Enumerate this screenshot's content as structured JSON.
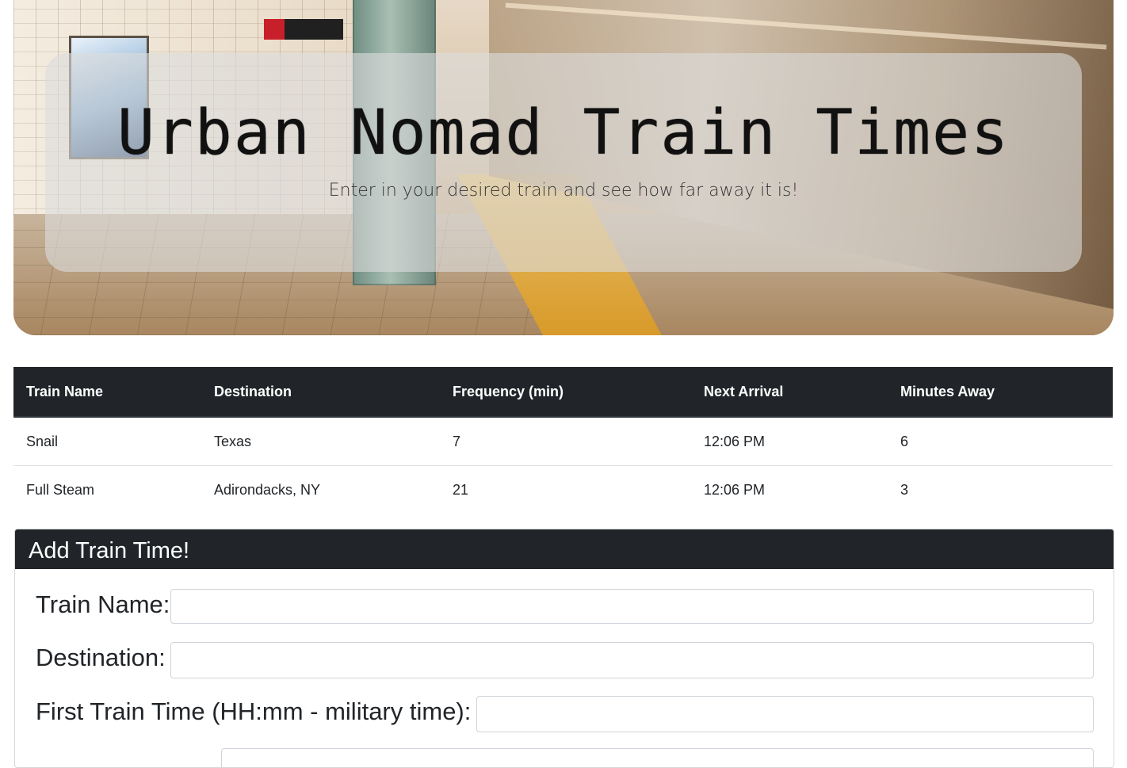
{
  "hero": {
    "title": "Urban Nomad Train Times",
    "subtitle": "Enter in your desired train and see how far away it is!"
  },
  "table": {
    "headers": [
      "Train Name",
      "Destination",
      "Frequency (min)",
      "Next Arrival",
      "Minutes Away"
    ],
    "rows": [
      [
        "Snail",
        "Texas",
        "7",
        "12:06 PM",
        "6"
      ],
      [
        "Full Steam",
        "Adirondacks, NY",
        "21",
        "12:06 PM",
        "3"
      ]
    ]
  },
  "form": {
    "header": "Add Train Time!",
    "fields": [
      {
        "label": "Train Name:",
        "value": ""
      },
      {
        "label": "Destination:",
        "value": ""
      },
      {
        "label": "First Train Time (HH:mm - military time):",
        "value": ""
      }
    ]
  },
  "colors": {
    "dark": "#212529",
    "border": "#dee2e6"
  }
}
